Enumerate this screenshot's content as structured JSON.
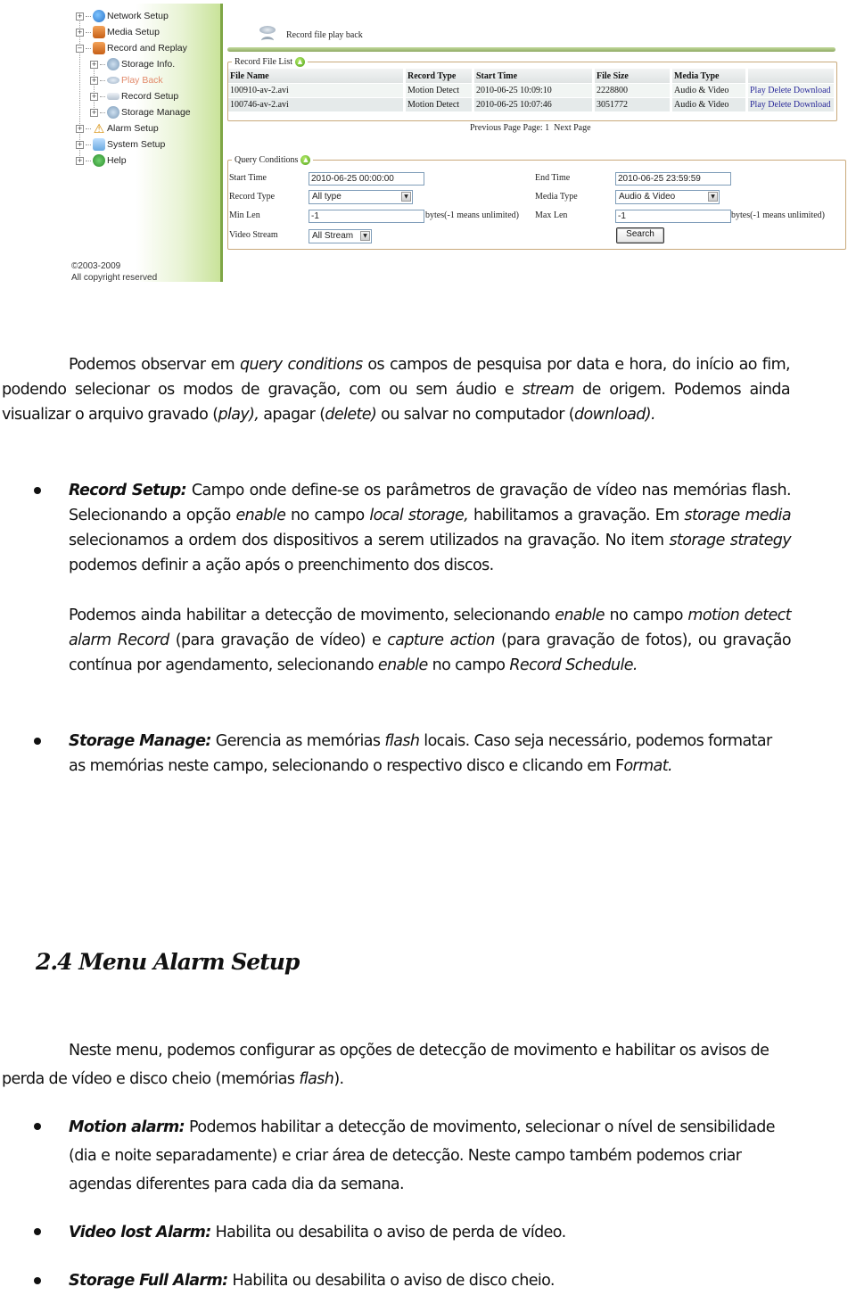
{
  "screenshot": {
    "sidebar": {
      "items": [
        {
          "label": "Network Setup",
          "icon": "network-globe-icon",
          "expander": "+",
          "level": 0
        },
        {
          "label": "Media Setup",
          "icon": "media-icon",
          "expander": "+",
          "level": 0
        },
        {
          "label": "Record and Replay",
          "icon": "record-replay-icon",
          "expander": "−",
          "level": 0
        },
        {
          "label": "Storage Info.",
          "icon": "storage-info-icon",
          "expander": "+",
          "level": 1
        },
        {
          "label": "Play Back",
          "icon": "playback-disc-icon",
          "expander": "+",
          "level": 1,
          "active": true
        },
        {
          "label": "Record Setup",
          "icon": "record-drive-icon",
          "expander": "+",
          "level": 1
        },
        {
          "label": "Storage Manage",
          "icon": "storage-manage-icon",
          "expander": "+",
          "level": 1
        },
        {
          "label": "Alarm Setup",
          "icon": "warning-icon",
          "expander": "+",
          "level": 0
        },
        {
          "label": "System Setup",
          "icon": "system-icon",
          "expander": "+",
          "level": 0
        },
        {
          "label": "Help",
          "icon": "help-icon",
          "expander": "+",
          "level": 0
        }
      ],
      "copyright_line1": "©2003-2009",
      "copyright_line2": "All copyright reserved"
    },
    "page_title": "Record file play back",
    "file_list": {
      "legend": "Record File List",
      "columns": [
        "File Name",
        "Record Type",
        "Start Time",
        "File Size",
        "Media Type",
        ""
      ],
      "rows": [
        {
          "file_name": "100910-av-2.avi",
          "record_type": "Motion Detect",
          "start_time": "2010-06-25 10:09:10",
          "file_size": "2228800",
          "media_type": "Audio & Video",
          "actions": [
            "Play",
            "Delete",
            "Download"
          ]
        },
        {
          "file_name": "100746-av-2.avi",
          "record_type": "Motion Detect",
          "start_time": "2010-06-25 10:07:46",
          "file_size": "3051772",
          "media_type": "Audio & Video",
          "actions": [
            "Play",
            "Delete",
            "Download"
          ]
        }
      ],
      "pager": {
        "previous": "Previous Page",
        "page_label": "Page: 1",
        "next": "Next Page"
      }
    },
    "query": {
      "legend": "Query Conditions",
      "start_time_label": "Start Time",
      "start_time_value": "2010-06-25 00:00:00",
      "end_time_label": "End Time",
      "end_time_value": "2010-06-25 23:59:59",
      "record_type_label": "Record Type",
      "record_type_value": "All type",
      "media_type_label": "Media Type",
      "media_type_value": "Audio & Video",
      "min_len_label": "Min Len",
      "min_len_value": "-1",
      "min_len_note": "bytes(-1 means unlimited)",
      "max_len_label": "Max Len",
      "max_len_value": "-1",
      "max_len_note": "bytes(-1 means unlimited)",
      "video_stream_label": "Video Stream",
      "video_stream_value": "All Stream",
      "search_label": "Search"
    }
  },
  "document": {
    "para1": {
      "t1": "Podemos observar em ",
      "i1": "query conditions",
      "t2": " os campos de pesquisa por data e hora, do início ao fim, podendo selecionar os modos de gravação, com ou sem áudio e ",
      "i2": "stream",
      "t3": " de origem. Podemos ainda visualizar o arquivo gravado (",
      "i3": "play),",
      "t4": " apagar (",
      "i4": "delete)",
      "t5": " ou salvar no computador (",
      "i5": "download)."
    },
    "record_setup": {
      "title": "Record Setup:",
      "t1": " Campo onde define-se os parâmetros de gravação de vídeo nas memórias flash. Selecionando a opção ",
      "i1": "enable",
      "t2": " no campo ",
      "i2": "local storage,",
      "t3": " habilitamos a gravação. Em ",
      "i3": "storage media",
      "t4": " selecionamos a ordem dos dispositivos a serem utilizados na gravação. No item ",
      "i4": "storage strategy",
      "t5": " podemos definir a ação após o preenchimento dos discos.",
      "p2_t1": "Podemos ainda habilitar a detecção de movimento, selecionando ",
      "p2_i1": "enable",
      "p2_t2": " no campo ",
      "p2_i2": "motion detect alarm Record",
      "p2_t3": " (para gravação de vídeo) e ",
      "p2_i3": "capture action",
      "p2_t4": " (para gravação de fotos), ou gravação contínua por agendamento, selecionando ",
      "p2_i4": "enable",
      "p2_t5": " no campo ",
      "p2_i5": "Record Schedule."
    },
    "storage_manage": {
      "title": "Storage Manage:",
      "t1": " Gerencia as memórias ",
      "i1": "flash",
      "t2": " locais. Caso seja necessário, podemos formatar as memórias neste campo, selecionando o respectivo disco e clicando em F",
      "i2": "ormat."
    },
    "heading": "2.4 Menu Alarm Setup",
    "para2": {
      "t1": "Neste menu, podemos configurar as opções de detecção de movimento e habilitar os avisos de perda de vídeo e disco cheio (memórias ",
      "i1": "flash",
      "t2": ")."
    },
    "motion_alarm": {
      "title": "Motion alarm:",
      "text": " Podemos habilitar a detecção de movimento, selecionar o nível de sensibilidade (dia e noite separadamente) e criar área de detecção. Neste campo também podemos criar agendas diferentes para cada dia da semana."
    },
    "video_lost_alarm": {
      "title": "Video lost Alarm:",
      "text": " Habilita ou desabilita o aviso de perda de vídeo."
    },
    "storage_full_alarm": {
      "title": "Storage Full Alarm:",
      "text": " Habilita ou desabilita o aviso de disco cheio."
    }
  }
}
